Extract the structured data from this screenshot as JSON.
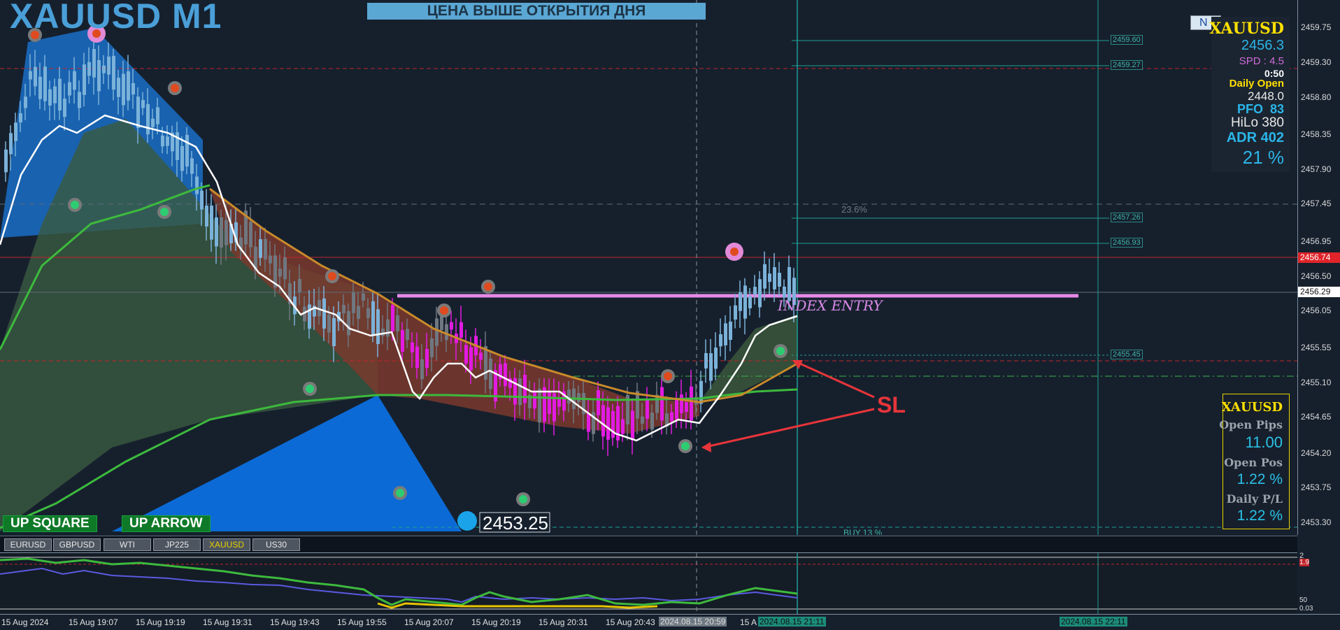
{
  "chart": {
    "symbol_title": "XAUUSD M1",
    "banner": "ЦЕНА ВЫШЕ ОТКРЫТИЯ ДНЯ",
    "index_entry_label": "INDEX ENTRY",
    "sl_label": "SL",
    "fib_level_label": "23.6%",
    "buy_label": "BUY 13 %",
    "low_marker": "2453.25",
    "up_square": "UP SQUARE",
    "up_arrow": "UP ARROW",
    "fib_prices": [
      "2459.60",
      "2459.27",
      "2457.26",
      "2456.93",
      "2455.45"
    ],
    "colors": {
      "background": "#16202d",
      "bull": "#7bb2d9",
      "bear": "#e21be2",
      "flat": "#6f7780",
      "ema_fast": "#ffffff",
      "ema_mid": "#c98a2a",
      "ema_slow": "#3dba3d",
      "teal": "#1f9e93"
    }
  },
  "price_scale": {
    "ticks": [
      "2459.75",
      "2459.30",
      "2458.80",
      "2458.35",
      "2457.90",
      "2457.45",
      "2456.95",
      "2456.50",
      "2456.05",
      "2455.55",
      "2455.10",
      "2454.65",
      "2454.20",
      "2453.75",
      "2453.30"
    ],
    "current_price_tag": "2456.74",
    "last_price_tag": "2456.29"
  },
  "info_panel": {
    "symbol": "XAUUSD",
    "price": "2456.3",
    "spread": "SPD : 4.5",
    "timer": "0:50",
    "daily_open_label": "Daily Open",
    "daily_open_value": "2448.0",
    "pfo_label": "PFO",
    "pfo_value": "83",
    "hilo_label": "HiLo",
    "hilo_value": "380",
    "adr_label": "ADR",
    "adr_value": "402",
    "percent": "21 %",
    "news_badge": "N"
  },
  "pl_panel": {
    "symbol": "XAUUSD",
    "open_pips_label": "Open Pips",
    "open_pips_value": "11.00",
    "open_pos_label": "Open Pos",
    "open_pos_value": "1.22 %",
    "daily_pl_label": "Daily P/L",
    "daily_pl_value": "1.22 %"
  },
  "symbol_tabs": [
    "EURUSD",
    "GBPUSD",
    "WTI",
    "JP225",
    "XAUUSD",
    "US30"
  ],
  "active_tab": "XAUUSD",
  "time_axis": {
    "labels": [
      "15 Aug 2024",
      "15 Aug 19:07",
      "15 Aug 19:19",
      "15 Aug 19:31",
      "15 Aug 19:43",
      "15 Aug 19:55",
      "15 Aug 20:07",
      "15 Aug 20:19",
      "15 Aug 20:31",
      "15 Aug 20:43",
      "15 A"
    ],
    "tag_crosshair": "2024.08.15 20:59",
    "tag_vline1": "2024.08.15 21:11",
    "tag_vline2": "2024.08.15 22:11"
  },
  "indicator_scale": {
    "top": "2",
    "mid": "1.9",
    "low": "50",
    "bottom": "0.03"
  }
}
